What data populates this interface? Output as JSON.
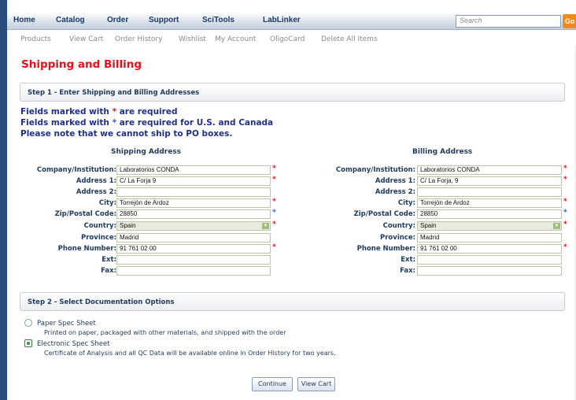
{
  "nav": {
    "items": [
      "Home",
      "Catalog",
      "Order",
      "Support",
      "SciTools",
      "LabLinker"
    ],
    "search_placeholder": "Search",
    "go_label": "Go"
  },
  "subnav": {
    "items": [
      "Products",
      "View Cart",
      "Order History",
      "Wishlist",
      "My Account",
      "OligoCard",
      "Delete All Items"
    ]
  },
  "page": {
    "title": "Shipping and Billing"
  },
  "step1": {
    "title": "Step 1 - Enter Shipping and Billing Addresses"
  },
  "notes": {
    "required_prefix": "Fields marked with ",
    "required_suffix": " are required",
    "usca_suffix": " are required for U.S. and Canada",
    "po_boxes": "Please note that we cannot ship to PO boxes.",
    "star": "*"
  },
  "labels": {
    "company": "Company/Institution:",
    "address1": "Address 1:",
    "address2": "Address 2:",
    "city": "City:",
    "zip": "Zip/Postal Code:",
    "country": "Country:",
    "province": "Province:",
    "phone": "Phone Number:",
    "ext": "Ext:",
    "fax": "Fax:"
  },
  "shipping": {
    "heading": "Shipping Address",
    "company": "Laboratorios CONDA",
    "address1": "C/ La Forja 9",
    "address2": "",
    "city": "Torrejón de Ardoz",
    "zip": "28850",
    "country": "Spain",
    "province": "Madrid",
    "phone": "91 761 02 00",
    "ext": "",
    "fax": ""
  },
  "billing": {
    "heading": "Billing Address",
    "company": "Laboratorios CONDA",
    "address1": "C/ La Forja, 9",
    "address2": "",
    "city": "Torrejón de Ardoz",
    "zip": "28850",
    "country": "Spain",
    "province": "Madrid",
    "phone": "91 761 02 00",
    "ext": "",
    "fax": ""
  },
  "step2": {
    "title": "Step 2 - Select Documentation Options",
    "options": [
      {
        "title": "Paper Spec Sheet",
        "desc": "Printed on paper, packaged with other materials, and shipped with the order",
        "checked": false
      },
      {
        "title": "Electronic Spec Sheet",
        "desc": "Certificate of Analysis and all QC Data will be available online in Order History for two years.",
        "checked": true
      }
    ]
  },
  "buttons": {
    "continue": "Continue",
    "view_cart": "View Cart"
  },
  "colors": {
    "title_red": "#e8101b",
    "nav_blue": "#1a3a66",
    "go_orange": "#f08a1c",
    "sidebar": "#2b4f7c"
  },
  "icons": {
    "dropdown": "chevron-down-icon",
    "required": "asterisk-icon"
  }
}
